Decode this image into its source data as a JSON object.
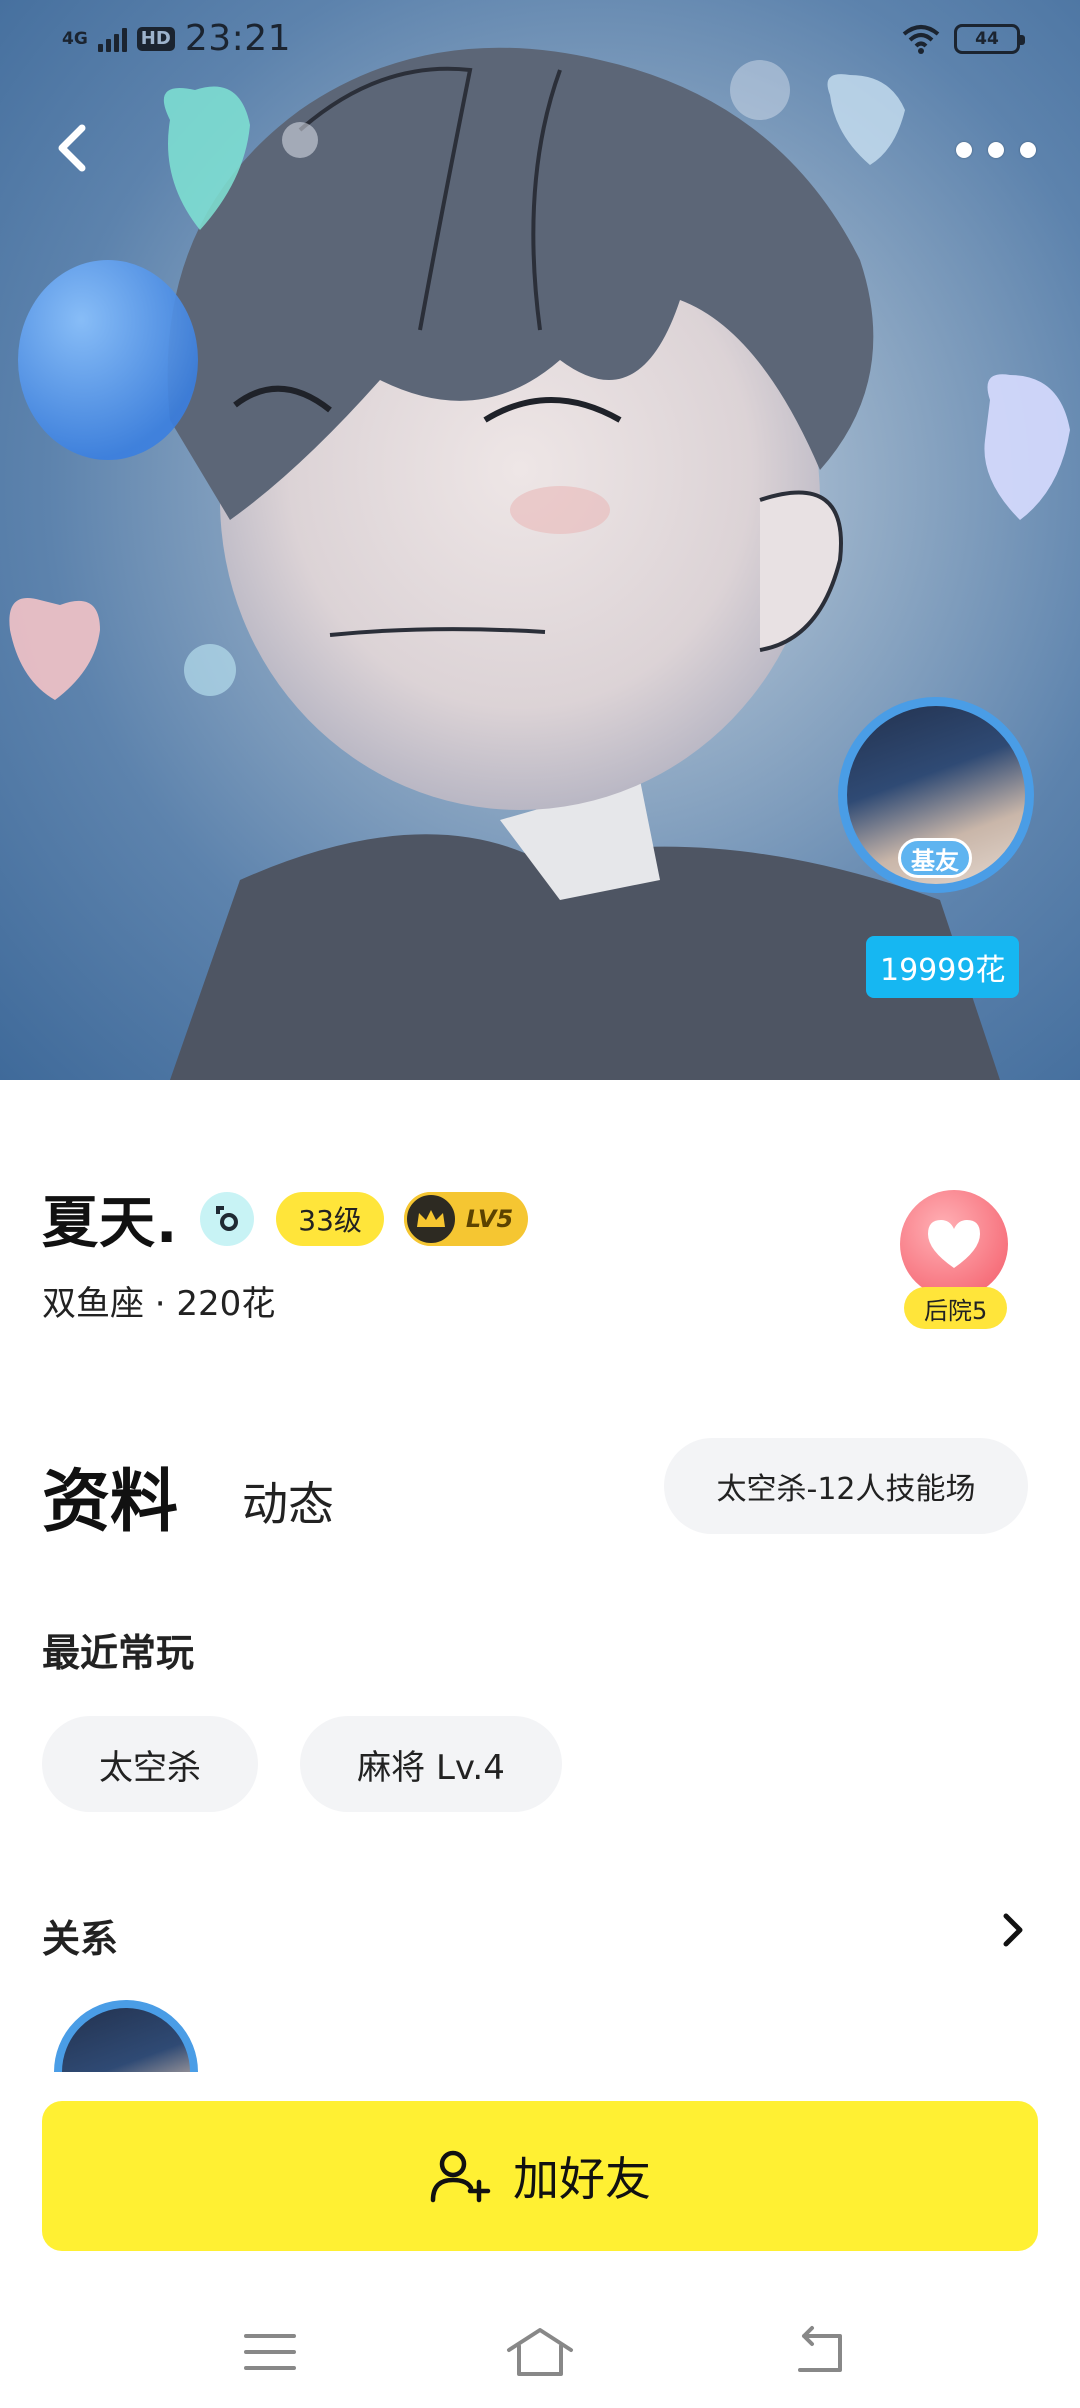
{
  "status_bar": {
    "network": "4G",
    "hd": "HD",
    "time": "23:21",
    "battery": "44"
  },
  "hero": {
    "friend_badge": "基友",
    "flower_count": "19999花"
  },
  "profile": {
    "name": "夏天.",
    "level": "33级",
    "vip": "LV5",
    "sub_info": "双鱼座 · 220花",
    "harem": "后院5"
  },
  "tabs": {
    "profile": "资料",
    "moments": "动态"
  },
  "current_room": "太空杀-12人技能场",
  "recent": {
    "title": "最近常玩",
    "games": [
      "太空杀",
      "麻将 Lv.4"
    ]
  },
  "relations": {
    "title": "关系"
  },
  "actions": {
    "add_friend": "加好友"
  },
  "colors": {
    "accent_yellow": "#fff033",
    "badge_blue": "#16b7f2",
    "ring_blue": "#4a9de6"
  },
  "icons": [
    "back-icon",
    "more-icon",
    "gender-icon",
    "crown-icon",
    "heart-icon",
    "chevron-right-icon",
    "add-user-icon",
    "menu-icon",
    "home-icon",
    "back-nav-icon"
  ]
}
